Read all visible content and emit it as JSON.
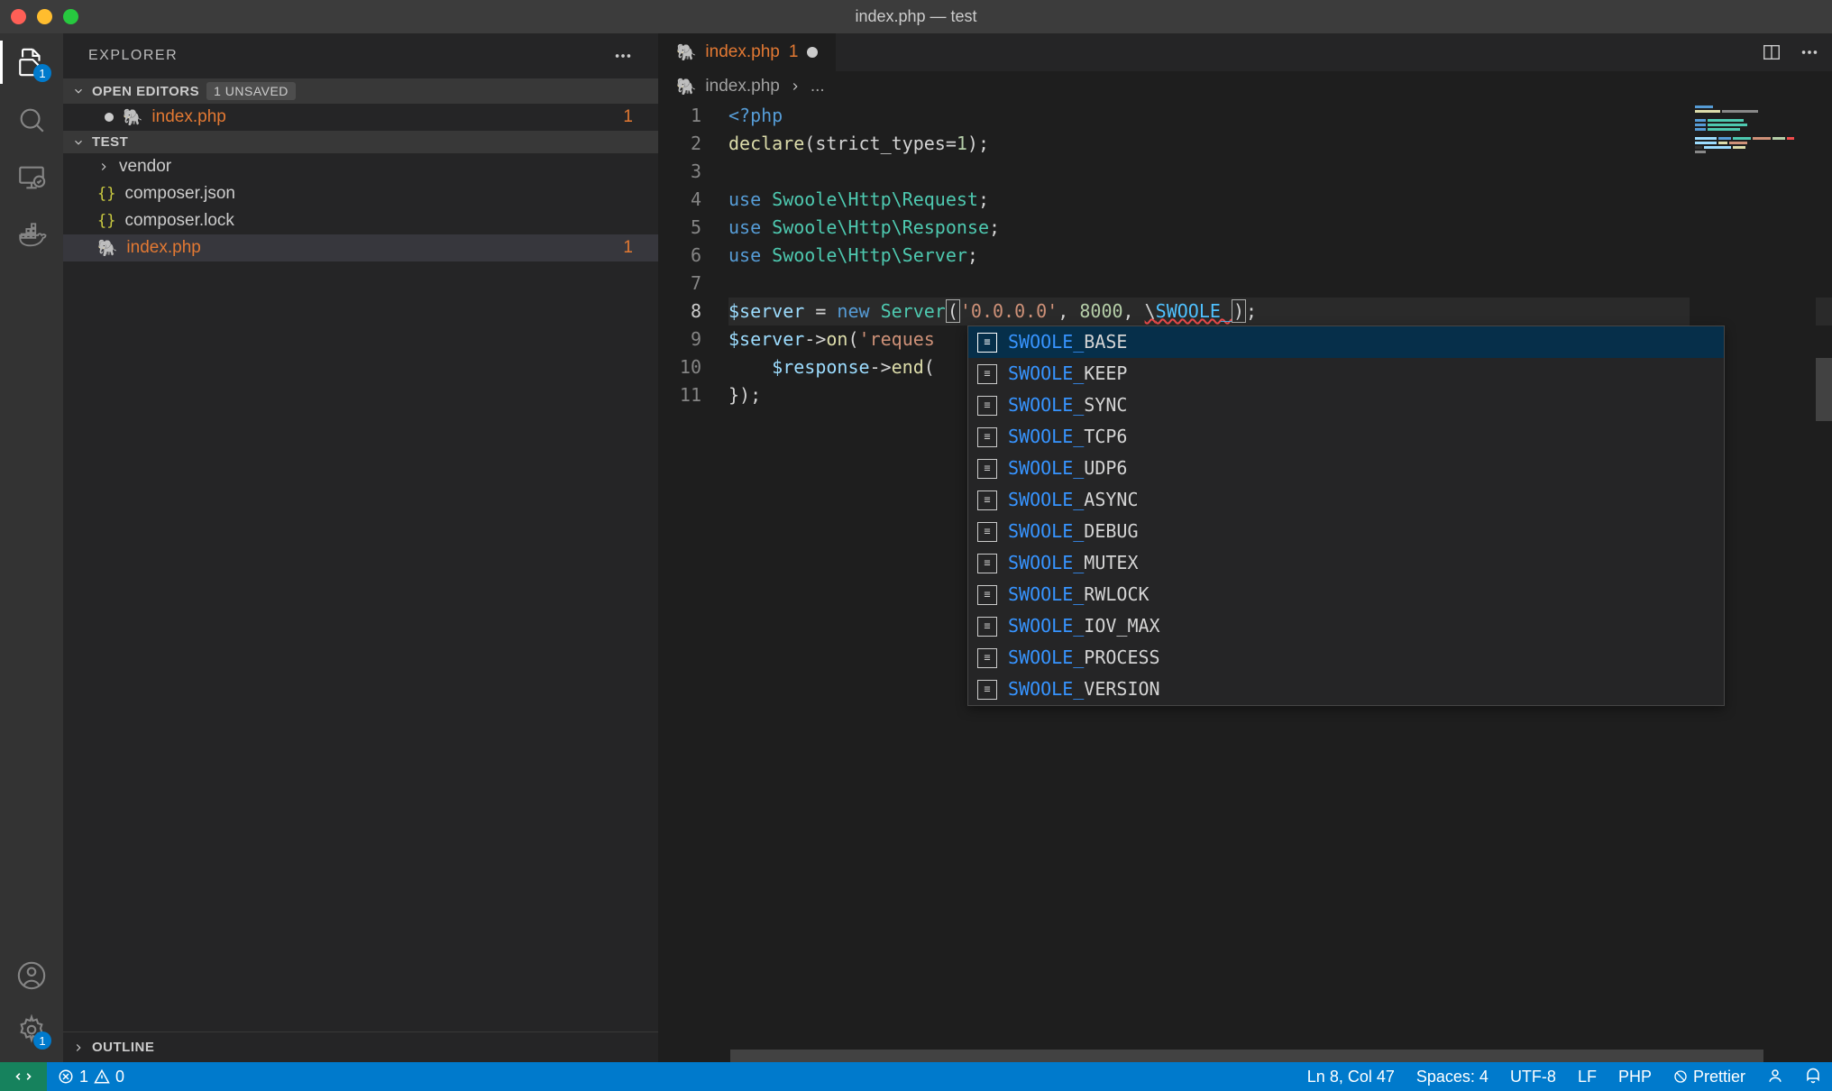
{
  "titlebar": {
    "title": "index.php — test"
  },
  "activitybar": {
    "explorer_badge": "1",
    "settings_badge": "1"
  },
  "sidebar": {
    "title": "EXPLORER",
    "open_editors": {
      "label": "OPEN EDITORS",
      "badge": "1 UNSAVED",
      "items": [
        {
          "name": "index.php",
          "count": "1",
          "dirty": true
        }
      ]
    },
    "folder": {
      "name": "TEST",
      "items": [
        {
          "kind": "folder",
          "name": "vendor"
        },
        {
          "kind": "json",
          "name": "composer.json"
        },
        {
          "kind": "json",
          "name": "composer.lock"
        },
        {
          "kind": "php",
          "name": "index.php",
          "count": "1",
          "active": true
        }
      ]
    },
    "outline_label": "OUTLINE"
  },
  "editor": {
    "tab": {
      "name": "index.php",
      "count": "1"
    },
    "breadcrumb": {
      "file": "index.php",
      "rest": "..."
    },
    "lines": [
      "1",
      "2",
      "3",
      "4",
      "5",
      "6",
      "7",
      "8",
      "9",
      "10",
      "11"
    ],
    "code": {
      "l1_open": "<?php",
      "l2_fn": "declare",
      "l2_arg": "(strict_types=",
      "l2_num": "1",
      "l2_end": ");",
      "l4_kw": "use",
      "l4_ns": " Swoole\\Http\\",
      "l4_cls": "Request",
      "l5_cls": "Response",
      "l6_cls": "Server",
      "l8_var": "$server",
      "l8_eq": " = ",
      "l8_new": "new",
      "l8_srv": " Server",
      "l8_p1": "(",
      "l8_str": "'0.0.0.0'",
      "l8_c1": ", ",
      "l8_port": "8000",
      "l8_c2": ", ",
      "l8_bs": "\\",
      "l8_const": "SWOOLE_",
      "l8_p2": ")",
      "l8_end": ";",
      "l9_var": "$server",
      "l9_fn": "on",
      "l9_arr": "->",
      "l9_p1": "(",
      "l9_str": "'reques",
      "l10_var": "$response",
      "l10_fn": "end",
      "l10_arr": "->",
      "l10_p": "(",
      "l11": "});"
    },
    "suggest_prefix": "SWOOLE_",
    "suggest": [
      "BASE",
      "KEEP",
      "SYNC",
      "TCP6",
      "UDP6",
      "ASYNC",
      "DEBUG",
      "MUTEX",
      "RWLOCK",
      "IOV_MAX",
      "PROCESS",
      "VERSION"
    ]
  },
  "statusbar": {
    "errors": "1",
    "warnings": "0",
    "cursor": "Ln 8, Col 47",
    "spaces": "Spaces: 4",
    "encoding": "UTF-8",
    "eol": "LF",
    "lang": "PHP",
    "prettier": "Prettier"
  }
}
